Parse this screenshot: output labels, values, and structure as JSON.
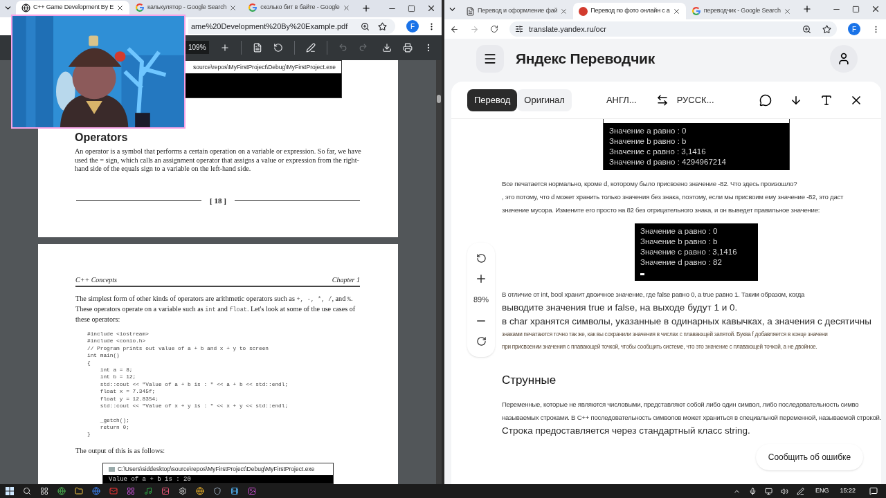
{
  "left_window": {
    "tabs": [
      {
        "title": "C++ Game Development By E",
        "selected": true
      },
      {
        "title": "калькулятор - Google Search",
        "selected": false
      },
      {
        "title": "сколько бит в байте - Google",
        "selected": false
      }
    ],
    "address": "ame%20Development%20By%20Example.pdf",
    "profile_initial": "F",
    "zoom": "109%",
    "page_1": {
      "console_title": "source\\repos\\MyFirstProject\\Debug\\MyFirstProject.exe",
      "heading": "Operators",
      "paragraph": "An operator is a symbol that performs a certain operation on a variable or expression. So far, we have used the = sign, which calls an assignment operator that assigns a value or expression from the right-hand side of the equals sign to a variable on the left-hand side.",
      "page_number": "[ 18 ]"
    },
    "page_2": {
      "header_left": "C++ Concepts",
      "header_right": "Chapter 1",
      "paragraph": [
        {
          "kind": "text",
          "text": "The simplest form of other kinds of operators are arithmetic operators such as "
        },
        {
          "kind": "code",
          "text": "+, -, *, /"
        },
        {
          "kind": "text",
          "text": ", and "
        },
        {
          "kind": "code",
          "text": "%"
        },
        {
          "kind": "text",
          "text": ". These operators operate on a variable such as "
        },
        {
          "kind": "code",
          "text": "int"
        },
        {
          "kind": "text",
          "text": " and "
        },
        {
          "kind": "code",
          "text": "float"
        },
        {
          "kind": "text",
          "text": ". Let's look at some of the use cases of these operators:"
        }
      ],
      "code": [
        [
          "#include <iostream>",
          "#include <conio.h>",
          "// Program prints out value of a + b and x + y to screen",
          "int main()",
          "{",
          "    int a = 8;",
          "    int b = 12;",
          "    std::cout << \"Value of a + b is : \" << a + b << std::endl;",
          "    float x = 7.345f;",
          "    float y = 12.8354;",
          "    std::cout << \"Value of x + y is : \" << x + y << std::endl;"
        ],
        [
          "    _getch();",
          "    return 0;",
          "}"
        ]
      ],
      "output_intro": "The output of this is as follows:",
      "console_title": "C:\\Users\\siddesktop\\source\\repos\\MyFirstProject\\Debug\\MyFirstProject.exe",
      "console_output": "Value of a + b is : 20"
    }
  },
  "right_window": {
    "tabs": [
      {
        "title": "Перевод и оформление фай",
        "selected": false
      },
      {
        "title": "Перевод по фото онлайн с а",
        "selected": true
      },
      {
        "title": "переводчик - Google Search",
        "selected": false
      }
    ],
    "address": "translate.yandex.ru/ocr",
    "profile_initial": "F",
    "site_title": "Яндекс Переводчик",
    "view_tabs": [
      {
        "label": "Перевод",
        "selected": true
      },
      {
        "label": "Оригинал",
        "selected": false
      }
    ],
    "source_language": "АНГЛ...",
    "target_language": "РУССК...",
    "blocks": [
      {
        "kind": "console",
        "lines": [
          "Значение a равно  : 0",
          "Значение b равно : b",
          "Значение c равно : 3,1416",
          "Значение d равно : 4294967214"
        ]
      },
      {
        "kind": "paragraph",
        "lines": [
          {
            "kind": "normal",
            "text": "Все печатается нормально, кроме d, которому было присвоено значение -82. Что здесь произошло?"
          },
          {
            "kind": "normal",
            "text": ", это потому, что d может хранить только значения без знака, поэтому, если мы присвоим ему значение -82, это даст"
          },
          {
            "kind": "normal",
            "text": "значение мусора. Измените его просто на 82 без отрицательного знака, и он выведет правильное значение:"
          }
        ]
      },
      {
        "kind": "console",
        "lines": [
          "Значение a равно : 0",
          "Значение b равно : b",
          "Значение c равно : 3,1416",
          "Значение d равно : 82"
        ]
      },
      {
        "kind": "paragraph",
        "lines": [
          {
            "kind": "normal",
            "text": "В отличие от int, bool хранит двоичное значение, где false равно 0, а true равно 1. Таким образом, когда"
          },
          {
            "kind": "large",
            "text": "выводите значения true и false, на выходе будут 1 и 0."
          },
          {
            "kind": "large",
            "text": "в char хранятся символы, указанные в одинарных кавычках, а значения с десятичны"
          },
          {
            "kind": "small",
            "text": "знаками печатаются точно так же, как вы сохранили значения в числах с плавающей запятой. Буква f добавляется в конце значени"
          },
          {
            "kind": "small",
            "text": "при присвоении значения с плавающей точкой, чтобы сообщить системе, что это значение с плавающей точкой, а не двойное."
          }
        ]
      },
      {
        "kind": "heading",
        "text": "Струнные"
      },
      {
        "kind": "paragraph",
        "lines": [
          {
            "kind": "normal",
            "text": "Переменные, которые не являются числовыми, представляют собой либо один символ, либо последовательность симво"
          },
          {
            "kind": "normal",
            "text": "называемых строками. В C++ последовательность символов может храниться в специальной переменной, называемой строкой."
          },
          {
            "kind": "large",
            "text": "Строка предоставляется через стандартный класс string."
          }
        ]
      }
    ],
    "zoom_level": "89%",
    "report_button": "Сообщить об ошибке"
  },
  "taskbar": {
    "language": "ENG",
    "time": "15:22"
  }
}
